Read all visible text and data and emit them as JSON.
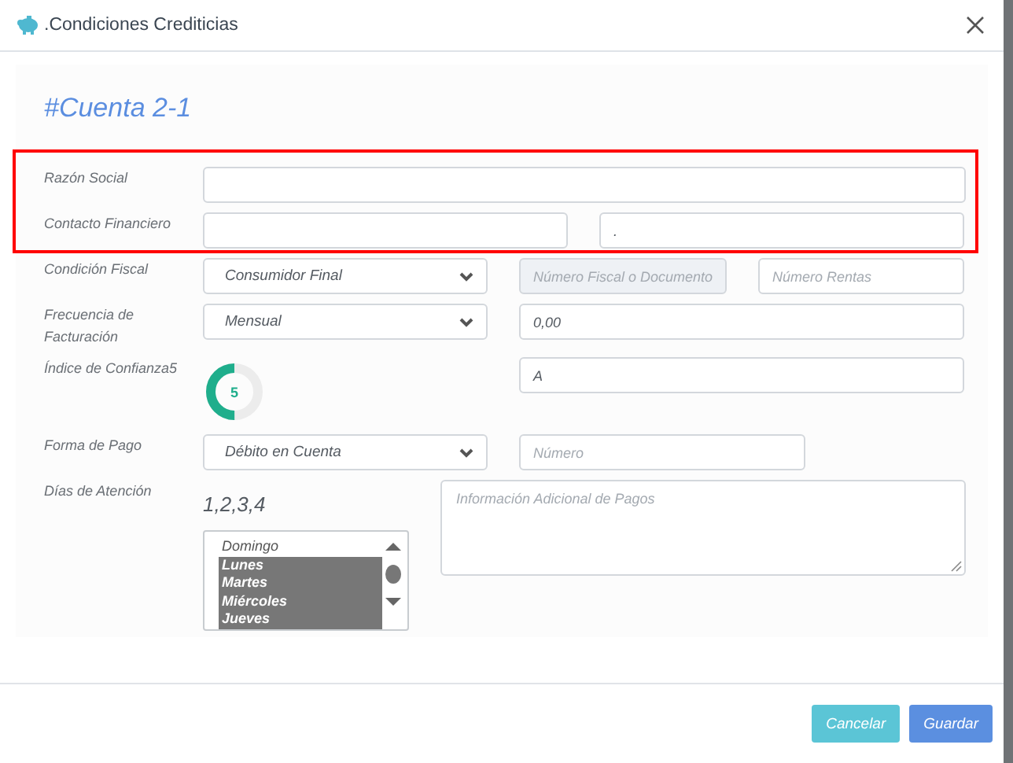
{
  "dialog": {
    "title": ".Condiciones Crediticias",
    "heading": "#Cuenta 2-1"
  },
  "rows": [
    {
      "label": "Razón Social",
      "controls": [
        {
          "kind": "input"
        }
      ]
    },
    {
      "label": "Contacto Financiero",
      "controls": [
        {
          "kind": "input"
        },
        {
          "kind": "input",
          "value": "."
        }
      ]
    },
    {
      "label": "Condición Fiscal",
      "controls": [
        {
          "kind": "select",
          "value": "Consumidor Final"
        },
        {
          "kind": "input",
          "placeholder": "Número Fiscal o Documento",
          "disabled": true
        },
        {
          "kind": "input",
          "placeholder": "Número Rentas",
          "disabled": false
        }
      ]
    },
    {
      "label": "Frecuencia de Facturación",
      "controls": [
        {
          "kind": "select",
          "value": "Mensual"
        },
        {
          "kind": "input",
          "value": "0,00"
        }
      ]
    },
    {
      "label": "Índice de Confianza5",
      "controls": [
        {
          "kind": "gauge",
          "value": "5",
          "level": 0.5
        },
        {
          "kind": "input",
          "value": "A"
        }
      ]
    },
    {
      "label": "Forma de Pago",
      "controls": [
        {
          "kind": "select",
          "value": "Débito en Cuenta"
        },
        {
          "kind": "input",
          "placeholder": "Número"
        }
      ]
    },
    {
      "label": "Días de Atención",
      "controls": [
        {
          "kind": "listbox",
          "value": "1,2,3,4",
          "options": [
            {
              "label": "Domingo",
              "selected": false
            },
            {
              "label": "Lunes",
              "selected": true
            },
            {
              "label": "Martes",
              "selected": true
            },
            {
              "label": "Miércoles",
              "selected": true
            },
            {
              "label": "Jueves",
              "selected": true
            }
          ]
        },
        {
          "kind": "textarea",
          "placeholder": "Información Adicional de Pagos"
        }
      ]
    }
  ],
  "buttons": [
    {
      "label": "Cancelar",
      "kind": "secondary"
    },
    {
      "label": "Guardar",
      "kind": "primary"
    }
  ]
}
